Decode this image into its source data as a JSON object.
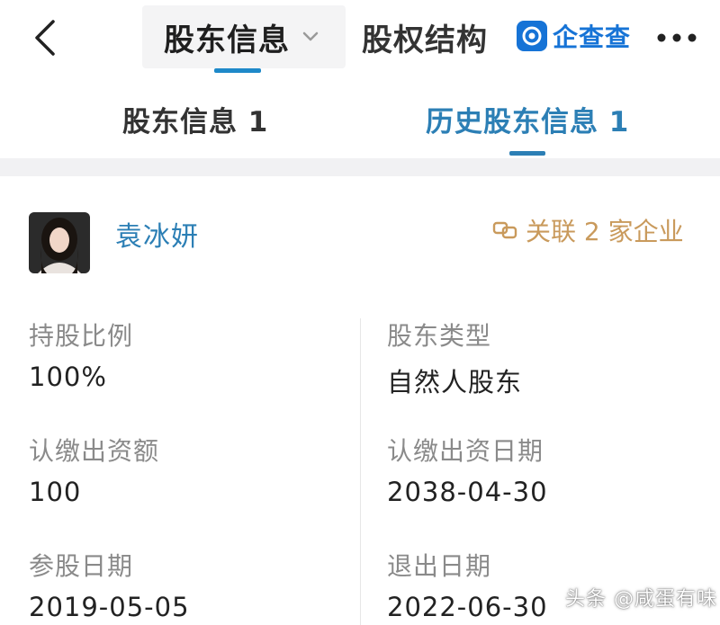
{
  "topbar": {
    "active_tab_label": "股东信息",
    "other_tab_label": "股权结构",
    "brand_name": "企查查"
  },
  "subtabs": {
    "tab1_label": "股东信息 1",
    "tab2_label": "历史股东信息 1"
  },
  "shareholder": {
    "name": "袁冰妍",
    "related_text": "关联 2 家企业"
  },
  "fields": {
    "shareholding_ratio": {
      "label": "持股比例",
      "value": "100%"
    },
    "shareholder_type": {
      "label": "股东类型",
      "value": "自然人股东"
    },
    "subscribed_amount": {
      "label": "认缴出资额",
      "value": "100"
    },
    "subscribed_date": {
      "label": "认缴出资日期",
      "value": "2038-04-30"
    },
    "join_date": {
      "label": "参股日期",
      "value": "2019-05-05"
    },
    "exit_date": {
      "label": "退出日期",
      "value": "2022-06-30"
    }
  },
  "watermark": "头条 @咸蛋有味",
  "colors": {
    "accent_blue": "#2c7fb5",
    "brand_blue": "#1673d6",
    "related_gold": "#c99a5c",
    "label_gray": "#8a8a8a"
  },
  "icons": [
    "back-icon",
    "chevron-down-icon",
    "brand-logo-icon",
    "more-icon",
    "link-icon"
  ]
}
